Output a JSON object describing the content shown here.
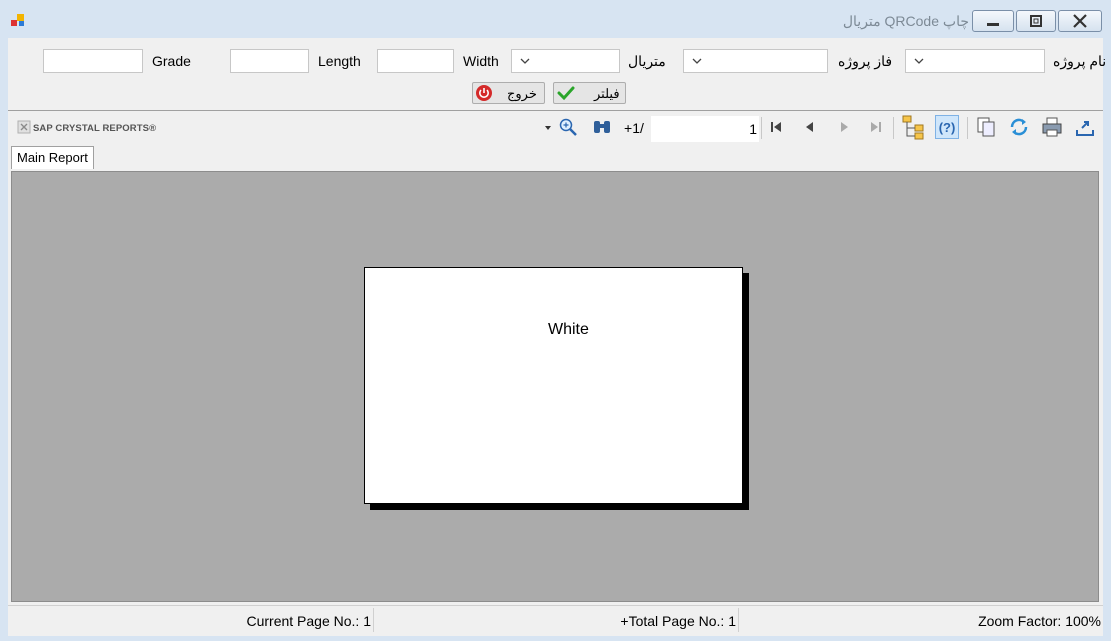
{
  "window": {
    "title": "چاپ QRCode متریال"
  },
  "filters": {
    "project_name_label": "نام پروژه",
    "project_name_value": "",
    "project_phase_label": "فاز پروژه",
    "project_phase_value": "",
    "material_label": "متریال",
    "material_value": "",
    "width_label": "Width",
    "width_value": "",
    "length_label": "Length",
    "length_value": "",
    "grade_label": "Grade",
    "grade_value": ""
  },
  "actions": {
    "filter_label": "فیلتر",
    "exit_label": "خروج"
  },
  "viewer_toolbar": {
    "brand": "SAP CRYSTAL REPORTS®",
    "page_of": "/1+",
    "page_value": "1"
  },
  "tabs": [
    {
      "label": "Main Report"
    }
  ],
  "report": {
    "content_text": "White"
  },
  "status": {
    "current_page": "Current Page No.: 1",
    "total_page": "Total Page No.: 1+",
    "zoom": "Zoom Factor: 100%"
  },
  "colors": {
    "accent_title": "#7d8a96",
    "viewer_bg": "#ababab"
  }
}
